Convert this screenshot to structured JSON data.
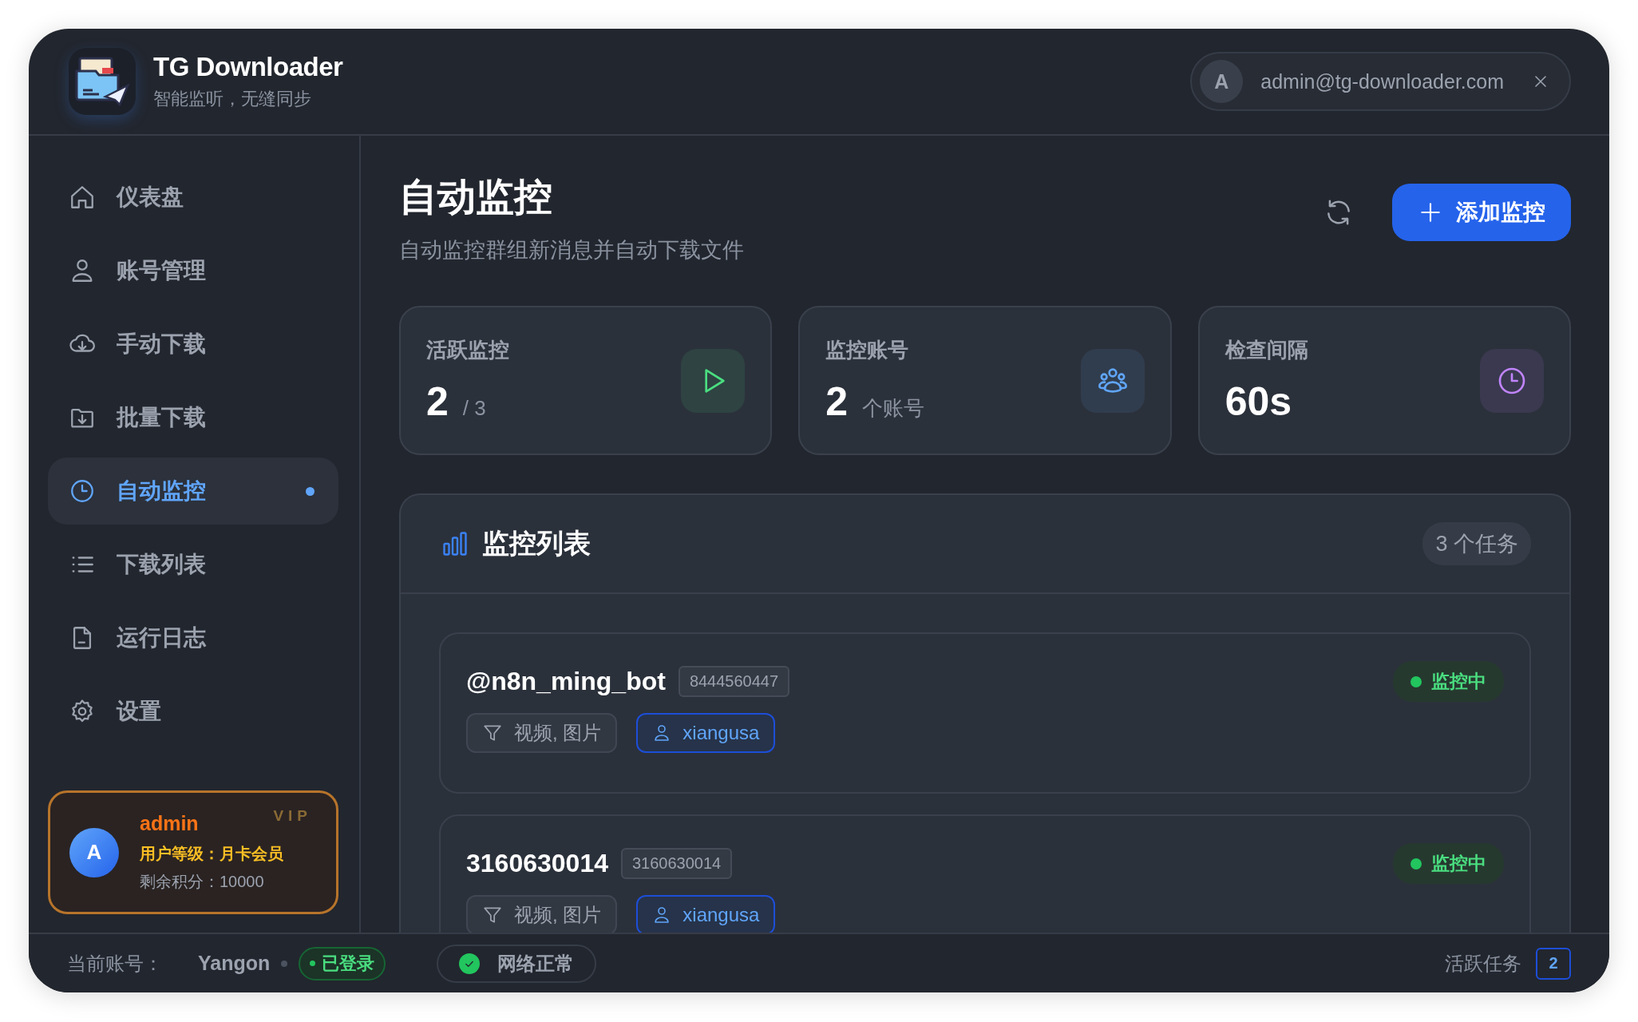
{
  "app": {
    "title": "TG Downloader",
    "subtitle": "智能监听，无缝同步"
  },
  "user_chip": {
    "avatar": "A",
    "email": "admin@tg-downloader.com"
  },
  "sidebar": {
    "items": [
      {
        "label": "仪表盘",
        "selected": false
      },
      {
        "label": "账号管理",
        "selected": false
      },
      {
        "label": "手动下载",
        "selected": false
      },
      {
        "label": "批量下载",
        "selected": false
      },
      {
        "label": "自动监控",
        "selected": true
      },
      {
        "label": "下载列表",
        "selected": false
      },
      {
        "label": "运行日志",
        "selected": false
      },
      {
        "label": "设置",
        "selected": false
      }
    ]
  },
  "vip_card": {
    "avatar": "A",
    "name": "admin",
    "badge": "VIP",
    "tier": "用户等级：月卡会员",
    "points": "剩余积分：10000"
  },
  "page": {
    "title": "自动监控",
    "subtitle": "自动监控群组新消息并自动下载文件",
    "add_button": "添加监控"
  },
  "stats": [
    {
      "label": "活跃监控",
      "value": "2",
      "unit": "/ 3",
      "color": "#4ade80"
    },
    {
      "label": "监控账号",
      "value": "2",
      "unit": "个账号",
      "color": "#60a5fa"
    },
    {
      "label": "检查间隔",
      "value": "60s",
      "color": "#c084fc"
    }
  ],
  "monitor_list": {
    "title": "监控列表",
    "count": "3 个任务",
    "items": [
      {
        "name": "@n8n_ming_bot",
        "id": "8444560447",
        "filter": "视频, 图片",
        "account": "xiangusa",
        "status": "监控中",
        "active": true
      },
      {
        "name": "3160630014",
        "id": "3160630014",
        "filter": "视频, 图片",
        "account": "xiangusa",
        "status": "监控中",
        "active": true
      }
    ]
  },
  "status_bar": {
    "account_label": "当前账号：",
    "account": "Yangon",
    "login": "已登录",
    "network": "网络正常",
    "active_label": "活跃任务",
    "active_count": "2"
  }
}
